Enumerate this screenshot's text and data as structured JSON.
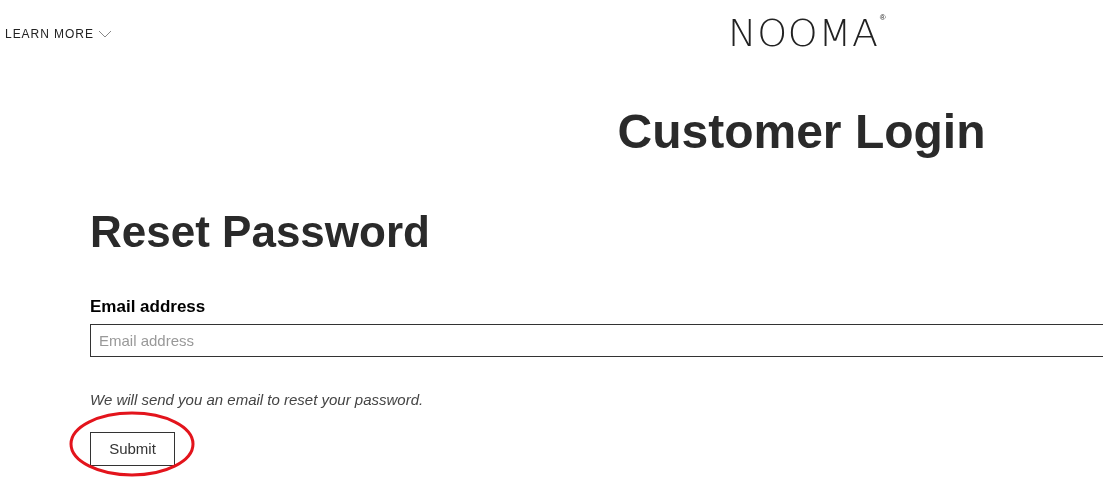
{
  "header": {
    "menu_label": "LEARN MORE",
    "logo": "NOOMA",
    "logo_mark": "®"
  },
  "page_title": "Customer Login",
  "form": {
    "title": "Reset Password",
    "email_label": "Email address",
    "email_placeholder": "Email address",
    "hint": "We will send you an email to reset your password.",
    "submit": "Submit",
    "submit_highlighted": true
  }
}
